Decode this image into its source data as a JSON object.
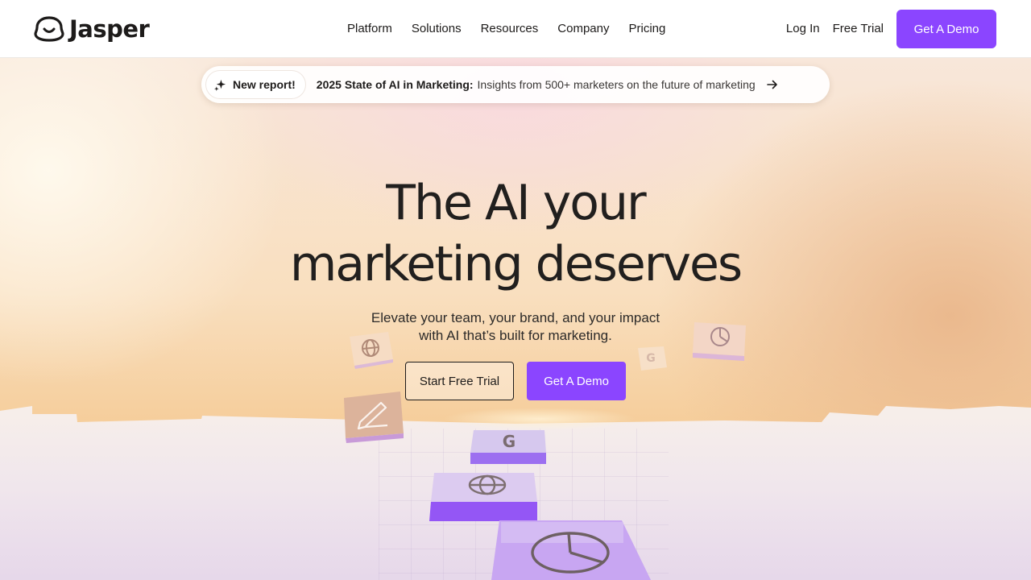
{
  "brand": {
    "name": "Jasper",
    "accent": "#8b45ff",
    "logo_icon": "smiley-face-icon"
  },
  "nav": {
    "items": [
      {
        "label": "Platform"
      },
      {
        "label": "Solutions"
      },
      {
        "label": "Resources"
      },
      {
        "label": "Company"
      },
      {
        "label": "Pricing"
      }
    ],
    "login_label": "Log In",
    "free_trial_label": "Free Trial",
    "demo_label": "Get A Demo"
  },
  "announcement": {
    "badge_icon": "sparkle-icon",
    "badge": "New report!",
    "title": "2025 State of AI in Marketing:",
    "body": "Insights from 500+ marketers on the future of marketing",
    "arrow_icon": "arrow-right-icon"
  },
  "hero": {
    "headline_line1": "The AI your",
    "headline_line2": "marketing deserves",
    "sub_line1": "Elevate your team, your brand, and your impact",
    "sub_line2": "with AI that’s built for marketing.",
    "cta_primary": "Start Free Trial",
    "cta_secondary": "Get A Demo"
  },
  "tiles": {
    "icons": [
      "google-g-icon",
      "globe-icon",
      "pie-chart-icon",
      "pencil-icon"
    ]
  }
}
